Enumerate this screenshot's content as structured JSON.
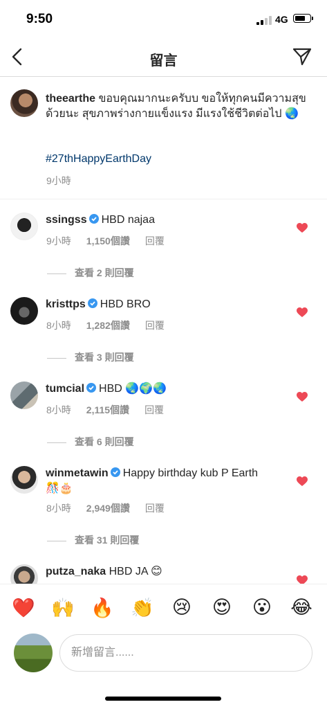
{
  "status_bar": {
    "time": "9:50",
    "network": "4G",
    "battery_level": 0.75
  },
  "header": {
    "title": "留言"
  },
  "caption": {
    "username": "theearthe",
    "text": "ขอบคุณมากนะครับบ ขอให้ทุกคนมีความสุขด้วยนะ สุขภาพร่างกายแข็งแรง มีแรงใช้ชีวิตต่อไป 🌏",
    "hashtag": "#27thHappyEarthDay",
    "time": "9小時"
  },
  "comments": [
    {
      "username": "ssingss",
      "text": "HBD najaa",
      "time": "9小時",
      "likes": "1,150個讚",
      "reply": "回覆",
      "view_replies": "查看 2 則回覆"
    },
    {
      "username": "kristtps",
      "text": "HBD BRO",
      "time": "8小時",
      "likes": "1,282個讚",
      "reply": "回覆",
      "view_replies": "查看 3 則回覆"
    },
    {
      "username": "tumcial",
      "text": "HBD 🌏🌍🌏",
      "time": "8小時",
      "likes": "2,115個讚",
      "reply": "回覆",
      "view_replies": "查看 6 則回覆"
    },
    {
      "username": "winmetawin",
      "text": "Happy birthday kub P Earth 🎊🎂",
      "time": "8小時",
      "likes": "2,949個讚",
      "reply": "回覆",
      "view_replies": "查看 31 則回覆"
    },
    {
      "username": "putza_naka",
      "text": "HBD JA 😊"
    }
  ],
  "emoji_bar": [
    "❤️",
    "🙌",
    "🔥",
    "👏",
    "😢",
    "😍",
    "😮",
    "😂"
  ],
  "composer": {
    "placeholder": "新增留言......"
  },
  "colors": {
    "heart": "#ed4956",
    "verified": "#3897f0",
    "hashtag": "#00376b",
    "meta": "#8e8e8e"
  }
}
